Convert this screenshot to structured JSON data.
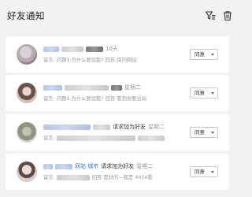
{
  "header": {
    "title": "好友通知",
    "icons": [
      "filter-icon",
      "trash-icon"
    ]
  },
  "notifications": [
    {
      "name_link": "",
      "action": "",
      "time": "10天",
      "message_label": "留言:",
      "message": "问题1:为什么要加我?  回答:询问网站",
      "button_label": "同意"
    },
    {
      "name_link": "",
      "action": "",
      "time": "星期二",
      "message_label": "留言:",
      "message": "问题1:为什么要加我?  回答:看到你要出站",
      "button_label": "同意"
    },
    {
      "name_link": "",
      "action": "请求加为好友",
      "time": "星期二",
      "message_label": "留言:",
      "message": "",
      "button_label": "同意"
    },
    {
      "name_link": "网站  城市",
      "action": "请求加为好友",
      "time": "星期二",
      "message_label": "留言:",
      "message": "回答:是好的—我是   4414看",
      "button_label": "同意"
    }
  ]
}
